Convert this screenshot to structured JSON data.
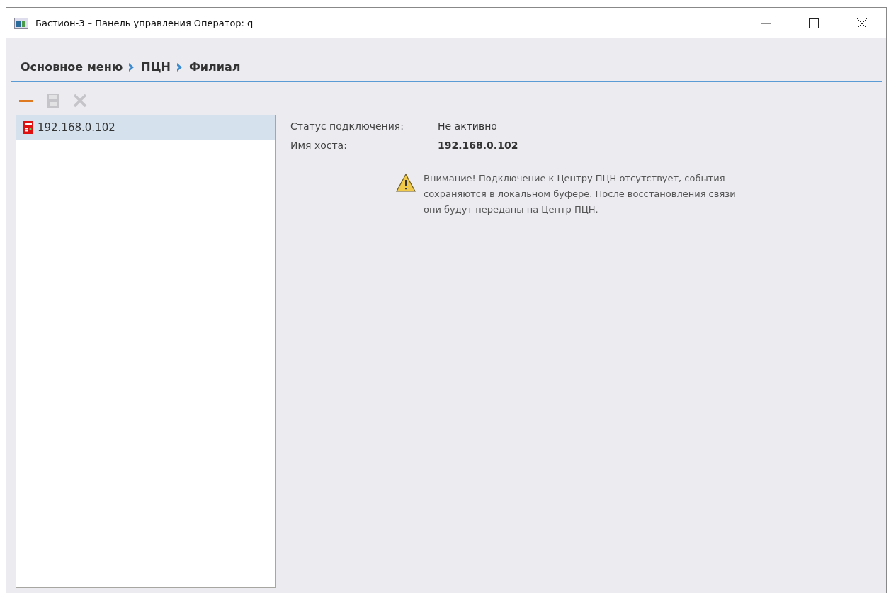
{
  "window": {
    "title": "Бастион-3 – Панель управления Оператор: q"
  },
  "breadcrumb": [
    {
      "label": "Основное меню"
    },
    {
      "label": "ПЦН"
    },
    {
      "label": "Филиал"
    }
  ],
  "toolbar": [
    {
      "kind": "remove",
      "disabled": false
    },
    {
      "kind": "save",
      "disabled": true
    },
    {
      "kind": "delete",
      "disabled": true
    }
  ],
  "list": [
    {
      "label": "192.168.0.102",
      "selected": true
    }
  ],
  "details": [
    {
      "label": "Статус подключения:",
      "value": "Не активно",
      "bold": false
    },
    {
      "label": "Имя хоста:",
      "value": "192.168.0.102",
      "bold": true
    }
  ],
  "warning": {
    "text": "Внимание! Подключение к Центру ПЦН отсутствует, события сохраняются в локальном буфере. После восстановления связи они будут переданы на Центр ПЦН."
  }
}
